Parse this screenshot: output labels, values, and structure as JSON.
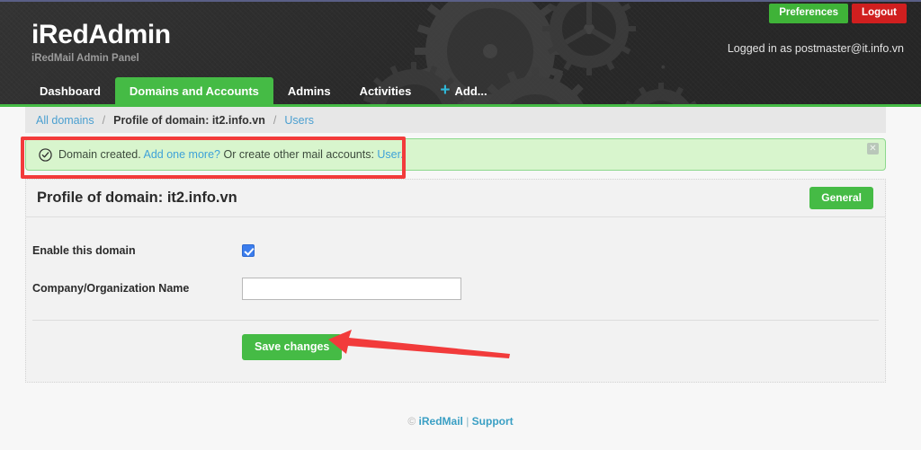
{
  "header": {
    "brand_title": "iRedAdmin",
    "brand_subtitle": "iRedMail Admin Panel",
    "preferences_label": "Preferences",
    "logout_label": "Logout",
    "logged_in_text": "Logged in as postmaster@it.info.vn",
    "accent_green": "#45bb45",
    "accent_red": "#d01f1f",
    "background": "#2f2f2f"
  },
  "nav": {
    "items": [
      {
        "label": "Dashboard",
        "active": false
      },
      {
        "label": "Domains and Accounts",
        "active": true
      },
      {
        "label": "Admins",
        "active": false
      },
      {
        "label": "Activities",
        "active": false
      }
    ],
    "add_label": "Add...",
    "add_icon": "plus-icon",
    "plus_color": "#2fb8d8"
  },
  "breadcrumb": {
    "all_domains": "All domains",
    "separator": "/",
    "current": "Profile of domain: it2.info.vn",
    "users": "Users"
  },
  "alert": {
    "icon": "check-circle-icon",
    "text_prefix": "Domain created.",
    "link_add_more": "Add one more?",
    "text_middle": "Or create other mail accounts:",
    "link_user": "User.",
    "close_icon": "close-icon",
    "background": "#d8f5cd",
    "border": "#8dd88d"
  },
  "panel": {
    "title": "Profile of domain: it2.info.vn",
    "general_label": "General",
    "fields": [
      {
        "label": "Enable this domain",
        "type": "checkbox",
        "checked": true
      },
      {
        "label": "Company/Organization Name",
        "type": "text",
        "value": "",
        "placeholder": ""
      }
    ],
    "save_label": "Save changes"
  },
  "footer": {
    "copyright_mark": "©",
    "product": "iRedMail",
    "divider": "|",
    "support": "Support"
  },
  "annotations": {
    "highlight_rect_color": "#f23b3b",
    "arrow_color": "#f23b3b"
  }
}
